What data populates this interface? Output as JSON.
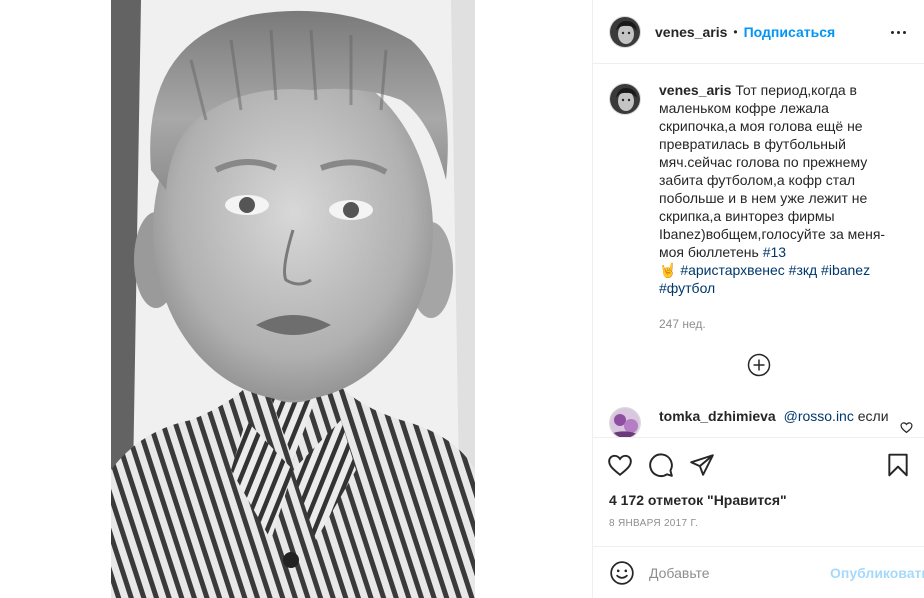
{
  "post": {
    "username": "venes_aris",
    "follow_label": "Подписаться",
    "dot": "•"
  },
  "caption": {
    "username": "venes_aris",
    "text": "Тот период,когда в маленьком кофре лежала скрипочка,а моя голова ещё не превратилась в футбольный мяч.сейчас голова по прежнему забита футболом,а кофр стал побольше и в нем уже лежит не скрипка,а винторез фирмы Ibanez)вобщем,голосуйте за меня-моя бюллетень ",
    "tag_13": "#13",
    "emoji": "🤘",
    "tags": [
      "#аристархвенес",
      "#зкд",
      "#ibanez",
      "#футбол"
    ],
    "time": "247 нед."
  },
  "comment": {
    "username": "tomka_dzhimieva",
    "mention": "@rosso.inc",
    "text": "если"
  },
  "stats": {
    "likes": "4 172 отметок \"Нравится\"",
    "date": "8 ЯНВАРЯ 2017 Г."
  },
  "add_comment": {
    "placeholder": "Добавьте",
    "publish_label": "Опубликовать"
  },
  "colors": {
    "accent": "#0095f6",
    "hashtag": "#00376b",
    "muted": "#8e8e8e",
    "border": "#efefef"
  },
  "icons": [
    "more-options-icon",
    "load-more-comments-icon",
    "heart-icon",
    "comment-icon",
    "share-icon",
    "save-icon",
    "emoji-icon",
    "small-heart-icon"
  ]
}
